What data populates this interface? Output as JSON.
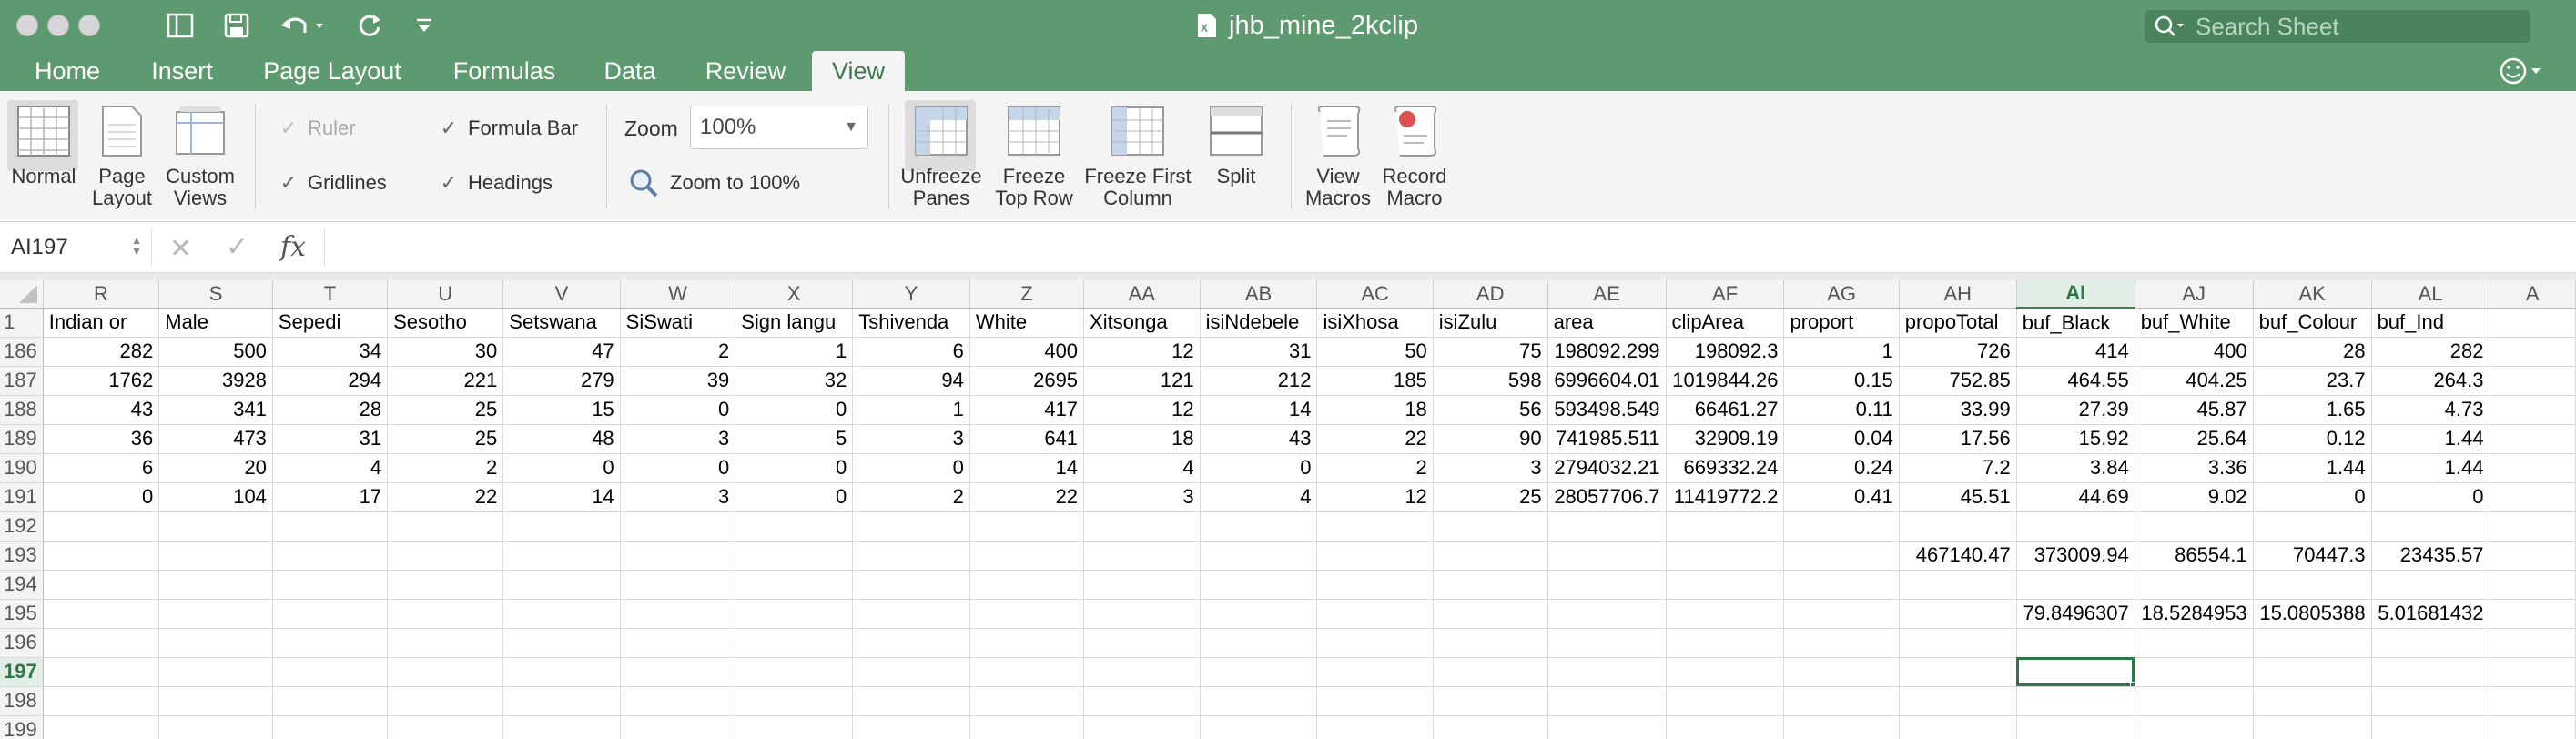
{
  "window": {
    "title": "jhb_mine_2kclip",
    "search_placeholder": "Search Sheet"
  },
  "tabs": [
    {
      "label": "Home"
    },
    {
      "label": "Insert"
    },
    {
      "label": "Page Layout"
    },
    {
      "label": "Formulas"
    },
    {
      "label": "Data"
    },
    {
      "label": "Review"
    },
    {
      "label": "View",
      "active": true
    }
  ],
  "ribbon": {
    "normal": "Normal",
    "page_layout": "Page\nLayout",
    "custom_views": "Custom\nViews",
    "ruler": "Ruler",
    "formula_bar": "Formula Bar",
    "gridlines": "Gridlines",
    "headings": "Headings",
    "zoom_label": "Zoom",
    "zoom_value": "100%",
    "zoom_100": "Zoom to 100%",
    "unfreeze_panes": "Unfreeze\nPanes",
    "freeze_top_row": "Freeze\nTop Row",
    "freeze_first_column": "Freeze First\nColumn",
    "split": "Split",
    "view_macros": "View\nMacros",
    "record_macro": "Record\nMacro"
  },
  "formula_bar": {
    "name_box": "AI197",
    "fx": "fx",
    "formula": ""
  },
  "grid": {
    "columns": [
      "R",
      "S",
      "T",
      "U",
      "V",
      "W",
      "X",
      "Y",
      "Z",
      "AA",
      "AB",
      "AC",
      "AD",
      "AE",
      "AF",
      "AG",
      "AH",
      "AI",
      "AJ",
      "AK",
      "AL",
      "A"
    ],
    "selected_column": "AI",
    "selected_row": "197",
    "rows": [
      {
        "n": "1",
        "cells": [
          "Indian or",
          "Male",
          "Sepedi",
          "Sesotho",
          "Setswana",
          "SiSwati",
          "Sign langu",
          "Tshivenda",
          "White",
          "Xitsonga",
          "isiNdebele",
          "isiXhosa",
          "isiZulu",
          "area",
          "clipArea",
          "proport",
          "propoTotal",
          "buf_Black",
          "buf_White",
          "buf_Colour",
          "buf_Ind",
          ""
        ]
      },
      {
        "n": "186",
        "cells": [
          "282",
          "500",
          "34",
          "30",
          "47",
          "2",
          "1",
          "6",
          "400",
          "12",
          "31",
          "50",
          "75",
          "198092.299",
          "198092.3",
          "1",
          "726",
          "414",
          "400",
          "28",
          "282",
          ""
        ]
      },
      {
        "n": "187",
        "cells": [
          "1762",
          "3928",
          "294",
          "221",
          "279",
          "39",
          "32",
          "94",
          "2695",
          "121",
          "212",
          "185",
          "598",
          "6996604.01",
          "1019844.26",
          "0.15",
          "752.85",
          "464.55",
          "404.25",
          "23.7",
          "264.3",
          ""
        ]
      },
      {
        "n": "188",
        "cells": [
          "43",
          "341",
          "28",
          "25",
          "15",
          "0",
          "0",
          "1",
          "417",
          "12",
          "14",
          "18",
          "56",
          "593498.549",
          "66461.27",
          "0.11",
          "33.99",
          "27.39",
          "45.87",
          "1.65",
          "4.73",
          ""
        ]
      },
      {
        "n": "189",
        "cells": [
          "36",
          "473",
          "31",
          "25",
          "48",
          "3",
          "5",
          "3",
          "641",
          "18",
          "43",
          "22",
          "90",
          "741985.511",
          "32909.19",
          "0.04",
          "17.56",
          "15.92",
          "25.64",
          "0.12",
          "1.44",
          ""
        ]
      },
      {
        "n": "190",
        "cells": [
          "6",
          "20",
          "4",
          "2",
          "0",
          "0",
          "0",
          "0",
          "14",
          "4",
          "0",
          "2",
          "3",
          "2794032.21",
          "669332.24",
          "0.24",
          "7.2",
          "3.84",
          "3.36",
          "1.44",
          "1.44",
          ""
        ]
      },
      {
        "n": "191",
        "cells": [
          "0",
          "104",
          "17",
          "22",
          "14",
          "3",
          "0",
          "2",
          "22",
          "3",
          "4",
          "12",
          "25",
          "28057706.7",
          "11419772.2",
          "0.41",
          "45.51",
          "44.69",
          "9.02",
          "0",
          "0",
          ""
        ]
      },
      {
        "n": "192",
        "cells": [
          "",
          "",
          "",
          "",
          "",
          "",
          "",
          "",
          "",
          "",
          "",
          "",
          "",
          "",
          "",
          "",
          "",
          "",
          "",
          "",
          "",
          ""
        ]
      },
      {
        "n": "193",
        "cells": [
          "",
          "",
          "",
          "",
          "",
          "",
          "",
          "",
          "",
          "",
          "",
          "",
          "",
          "",
          "",
          "",
          "467140.47",
          "373009.94",
          "86554.1",
          "70447.3",
          "23435.57",
          ""
        ]
      },
      {
        "n": "194",
        "cells": [
          "",
          "",
          "",
          "",
          "",
          "",
          "",
          "",
          "",
          "",
          "",
          "",
          "",
          "",
          "",
          "",
          "",
          "",
          "",
          "",
          "",
          ""
        ]
      },
      {
        "n": "195",
        "cells": [
          "",
          "",
          "",
          "",
          "",
          "",
          "",
          "",
          "",
          "",
          "",
          "",
          "",
          "",
          "",
          "",
          "",
          "79.8496307",
          "18.5284953",
          "15.0805388",
          "5.01681432",
          ""
        ]
      },
      {
        "n": "196",
        "cells": [
          "",
          "",
          "",
          "",
          "",
          "",
          "",
          "",
          "",
          "",
          "",
          "",
          "",
          "",
          "",
          "",
          "",
          "",
          "",
          "",
          "",
          ""
        ]
      },
      {
        "n": "197",
        "cells": [
          "",
          "",
          "",
          "",
          "",
          "",
          "",
          "",
          "",
          "",
          "",
          "",
          "",
          "",
          "",
          "",
          "",
          "",
          "",
          "",
          "",
          ""
        ]
      },
      {
        "n": "198",
        "cells": [
          "",
          "",
          "",
          "",
          "",
          "",
          "",
          "",
          "",
          "",
          "",
          "",
          "",
          "",
          "",
          "",
          "",
          "",
          "",
          "",
          "",
          ""
        ]
      },
      {
        "n": "199",
        "cells": [
          "",
          "",
          "",
          "",
          "",
          "",
          "",
          "",
          "",
          "",
          "",
          "",
          "",
          "",
          "",
          "",
          "",
          "",
          "",
          "",
          "",
          ""
        ]
      }
    ]
  },
  "colors": {
    "accent": "#5e9a6f",
    "selection": "#2f7548"
  }
}
